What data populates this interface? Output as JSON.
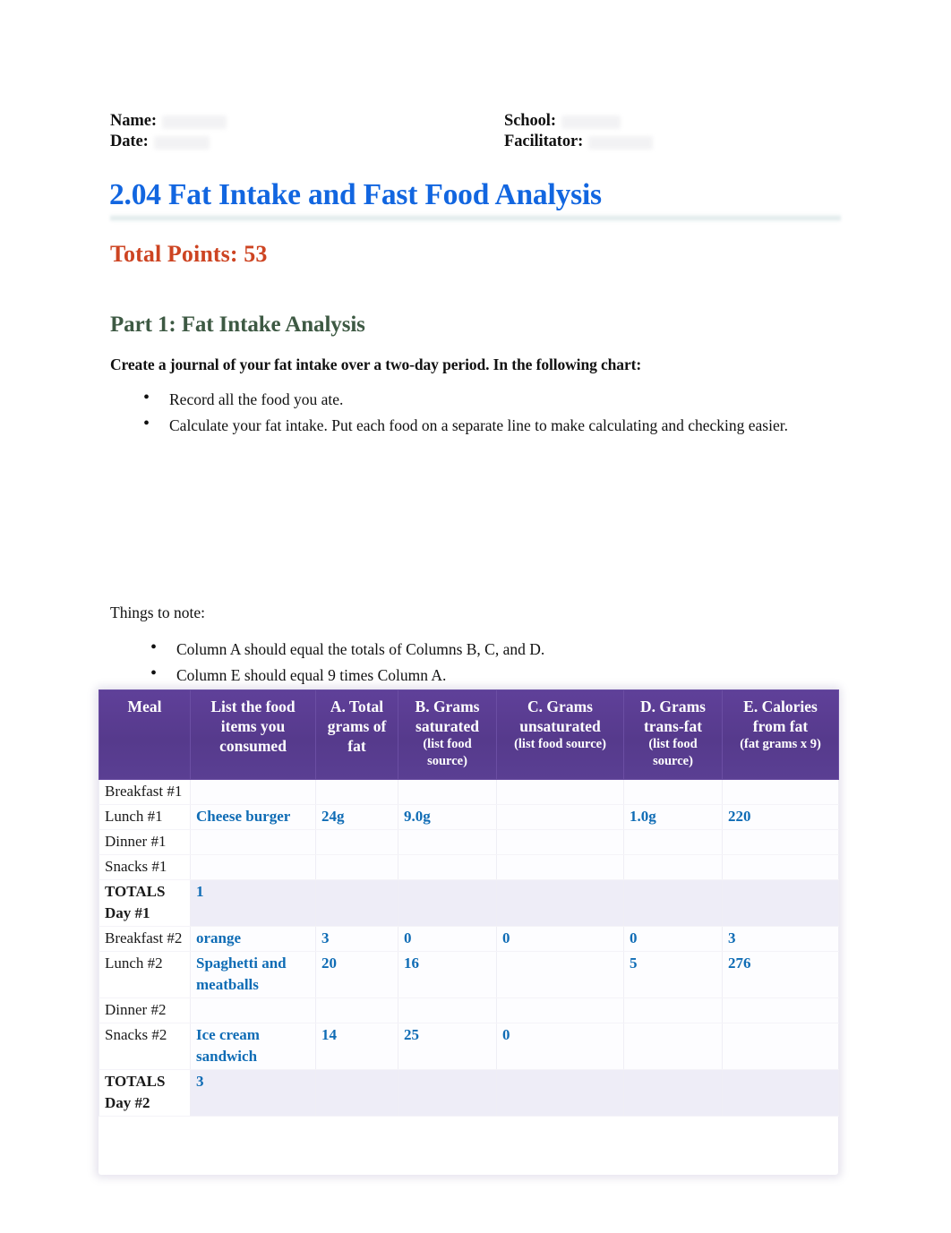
{
  "meta": {
    "name_label": "Name:",
    "date_label": "Date:",
    "school_label": "School:",
    "facilitator_label": "Facilitator:",
    "name_value": "",
    "date_value": "",
    "school_value": "",
    "facilitator_value": ""
  },
  "document": {
    "title": "2.04 Fat Intake and Fast Food Analysis",
    "total_points": "Total Points: 53",
    "title_color": "#1266e0",
    "points_color": "#cd4422",
    "heading_color": "#3d5943",
    "value_color": "#0f6cb5",
    "table_header_color": "#5a3f93"
  },
  "part1": {
    "heading": "Part 1: Fat Intake Analysis",
    "lead": "Create a journal of your fat intake over a two-day period. In the following chart:",
    "bullets": [
      "Record all the food you ate.",
      "Calculate your fat intake. Put each food on a separate line to make calculating and checking easier."
    ]
  },
  "notes": {
    "intro": "Things to note:",
    "bullets": [
      "Column A should equal the totals of Columns B, C, and D.",
      "Column E should equal 9 times Column A."
    ]
  },
  "table": {
    "headers": [
      {
        "main": "Meal",
        "sub": ""
      },
      {
        "main": "List the food items you consumed",
        "sub": ""
      },
      {
        "main": "A. Total grams of fat",
        "sub": ""
      },
      {
        "main": "B. Grams saturated",
        "sub": "(list food source)"
      },
      {
        "main": "C. Grams unsaturated",
        "sub": "(list food source)"
      },
      {
        "main": "D. Grams trans-fat",
        "sub": "(list food source)"
      },
      {
        "main": "E. Calories from fat",
        "sub": "(fat grams x 9)"
      }
    ],
    "rows": [
      {
        "meal": "Breakfast #1",
        "food": "",
        "a": "",
        "b": "",
        "c": "",
        "d": "",
        "e": "",
        "totals": false
      },
      {
        "meal": "Lunch #1",
        "food": "Cheese burger",
        "a": "24g",
        "b": "9.0g",
        "c": "",
        "d": "1.0g",
        "e": "220",
        "totals": false
      },
      {
        "meal": "Dinner #1",
        "food": "",
        "a": "",
        "b": "",
        "c": "",
        "d": "",
        "e": "",
        "totals": false
      },
      {
        "meal": "Snacks #1",
        "food": "",
        "a": "",
        "b": "",
        "c": "",
        "d": "",
        "e": "",
        "totals": false
      },
      {
        "meal": "TOTALS Day #1",
        "food": "1",
        "a": "",
        "b": "",
        "c": "",
        "d": "",
        "e": "",
        "totals": true
      },
      {
        "meal": "Breakfast #2",
        "food": "orange",
        "a": "3",
        "b": "0",
        "c": "0",
        "d": "0",
        "e": "3",
        "totals": false
      },
      {
        "meal": "Lunch #2",
        "food": "Spaghetti and meatballs",
        "a": "20",
        "b": "16",
        "c": "",
        "d": "5",
        "e": "276",
        "totals": false
      },
      {
        "meal": "Dinner #2",
        "food": "",
        "a": "",
        "b": "",
        "c": "",
        "d": "",
        "e": "",
        "totals": false
      },
      {
        "meal": "Snacks #2",
        "food": "Ice cream sandwich",
        "a": "14",
        "b": "25",
        "c": "0",
        "d": "",
        "e": "",
        "totals": false
      },
      {
        "meal": "TOTALS Day #2",
        "food": "3",
        "a": "",
        "b": "",
        "c": "",
        "d": "",
        "e": "",
        "totals": true
      }
    ]
  }
}
